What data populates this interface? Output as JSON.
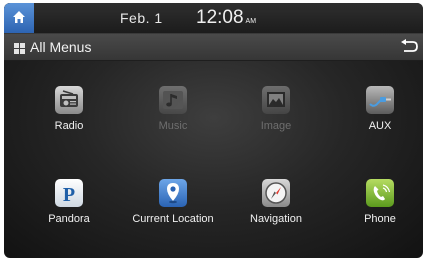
{
  "status_bar": {
    "date": "Feb.  1",
    "time": "12:08",
    "ampm": "AM"
  },
  "title_bar": {
    "title": "All Menus"
  },
  "menu_items": [
    {
      "label": "Radio",
      "icon": "radio-icon",
      "enabled": true
    },
    {
      "label": "Music",
      "icon": "music-icon",
      "enabled": false
    },
    {
      "label": "Image",
      "icon": "image-icon",
      "enabled": false
    },
    {
      "label": "AUX",
      "icon": "aux-cable-icon",
      "enabled": true
    },
    {
      "label": "Pandora",
      "icon": "pandora-icon",
      "enabled": true
    },
    {
      "label": "Current Location",
      "icon": "location-pin-icon",
      "enabled": true
    },
    {
      "label": "Navigation",
      "icon": "compass-icon",
      "enabled": true
    },
    {
      "label": "Phone",
      "icon": "phone-icon",
      "enabled": true
    }
  ],
  "colors": {
    "home_button": "#3d78c8",
    "background": "#262626",
    "disabled_text": "#6e6e6e"
  }
}
